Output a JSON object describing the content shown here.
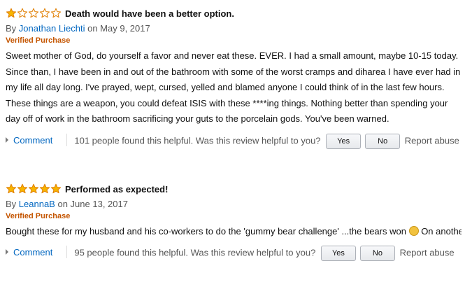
{
  "reviews": [
    {
      "rating": 1,
      "rating_max": 5,
      "title": "Death would have been a better option.",
      "by": "By",
      "author": "Jonathan Liechti",
      "date": "on May 9, 2017",
      "verified": "Verified Purchase",
      "body": "Sweet mother of God, do yourself a favor and never eat these. EVER. I had a small amount, maybe 10-15 today. Since than, I have been in and out of the bathroom with some of the worst cramps and diharea I have ever had in my life all day long. I've prayed, wept, cursed, yelled and blamed anyone I could think of in the last few hours. These things are a weapon, you could defeat ISIS with these ****ing things. Nothing better than spending your day off of work in the bathroom sacrificing your guts to the porcelain gods. You've been warned.",
      "comment": "Comment",
      "helpful": "101 people found this helpful. Was this review helpful to you?",
      "yes": "Yes",
      "no": "No",
      "report": "Report abuse"
    },
    {
      "rating": 5,
      "rating_max": 5,
      "title": "Performed as expected!",
      "by": "By",
      "author": "LeannaB",
      "date": "on June 13, 2017",
      "verified": "Verified Purchase",
      "body": "Bought these for my husband and his co-workers to do the 'gummy bear challenge' ...the bears won",
      "body_after": " On another note, they are tasty and if you don't mind all the rumbling, farting and diarrhea, have a handful",
      "comment": "Comment",
      "helpful": "95 people found this helpful. Was this review helpful to you?",
      "yes": "Yes",
      "no": "No",
      "report": "Report abuse"
    }
  ],
  "colors": {
    "star_fill": "#f7b500",
    "star_border": "#e07e00",
    "link": "#0066c0",
    "verified": "#c45500"
  },
  "icons": [
    "star-filled-icon",
    "star-empty-icon",
    "expand-triangle-icon",
    "grinning-emoji-icon"
  ]
}
